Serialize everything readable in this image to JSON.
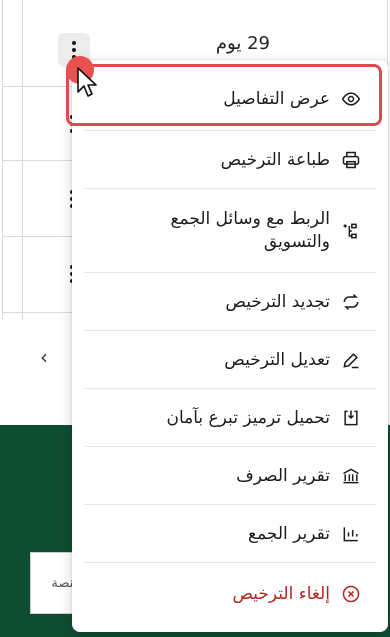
{
  "table": {
    "days_remaining": "29 يوم"
  },
  "platform_field": {
    "text": "لمنصة"
  },
  "pager": {
    "prev_symbol": "‹"
  },
  "menu": {
    "items": [
      {
        "label": "عرض التفاصيل",
        "icon": "eye-icon"
      },
      {
        "label": "طباعة الترخيص",
        "icon": "printer-icon"
      },
      {
        "label": "الربط مع وسائل الجمع والتسويق",
        "icon": "link-tree-icon"
      },
      {
        "label": "تجديد الترخيص",
        "icon": "renew-icon"
      },
      {
        "label": "تعديل الترخيص",
        "icon": "pencil-icon"
      },
      {
        "label": "تحميل ترميز تبرع بآمان",
        "icon": "download-code-icon"
      },
      {
        "label": "تقرير الصرف",
        "icon": "bank-icon"
      },
      {
        "label": "تقرير الجمع",
        "icon": "bar-chart-icon"
      },
      {
        "label": "إلغاء الترخيص",
        "icon": "cancel-circle-icon"
      }
    ]
  },
  "colors": {
    "danger": "#b3261e",
    "highlight": "#e04a4f",
    "green_band": "#0f4d32"
  }
}
